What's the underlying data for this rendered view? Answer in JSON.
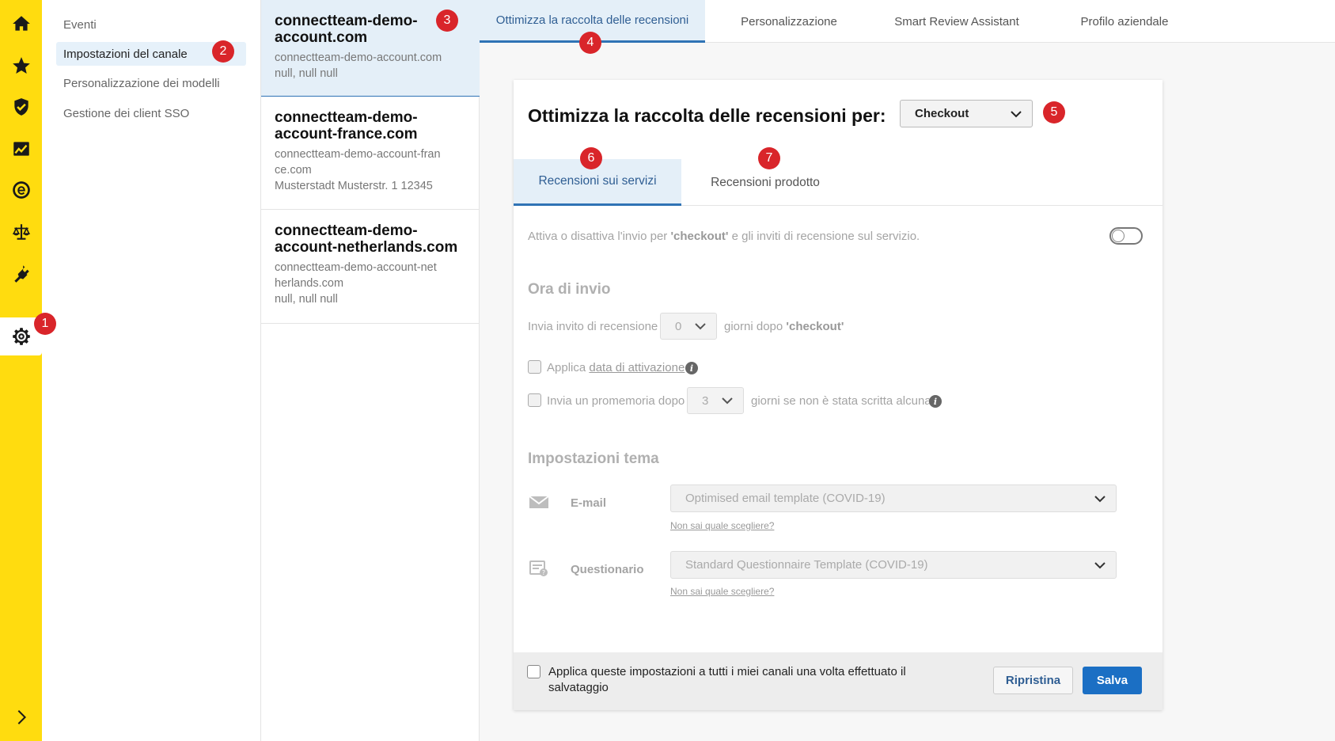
{
  "rail": {
    "items": [
      {
        "icon": "home-icon"
      },
      {
        "icon": "star-icon"
      },
      {
        "icon": "shield-check-icon"
      },
      {
        "icon": "analytics-icon"
      },
      {
        "icon": "e-circle-icon"
      },
      {
        "icon": "scales-icon"
      },
      {
        "icon": "plug-icon"
      },
      {
        "icon": "gear-icon"
      }
    ],
    "expand_icon": "chevron-right-icon"
  },
  "badges": [
    "1",
    "2",
    "3",
    "4",
    "5",
    "6",
    "7"
  ],
  "nav": {
    "items": [
      "Eventi",
      "Impostazioni del canale",
      "Personalizzazione dei modelli",
      "Gestione dei client SSO"
    ]
  },
  "accounts": [
    {
      "title": "connectteam-demo-account.com",
      "domain": "connectteam-demo-account.com",
      "address": "null, null null"
    },
    {
      "title": "connectteam-demo-account-france.com",
      "domain": "connectteam-demo-account-france.com",
      "address": "Musterstadt Musterstr. 1 12345"
    },
    {
      "title": "connectteam-demo-account-netherlands.com",
      "domain": "connectteam-demo-account-netherlands.com",
      "address": "null, null null"
    }
  ],
  "tabs": [
    "Ottimizza la raccolta delle recensioni",
    "Personalizzazione",
    "Smart Review Assistant",
    "Profilo aziendale"
  ],
  "card": {
    "title": "Ottimizza la raccolta delle recensioni per:",
    "event_select": "Checkout",
    "subtabs": [
      "Recensioni sui servizi",
      "Recensioni prodotto"
    ],
    "toggle_text_pre": "Attiva o disattiva l'invio per ",
    "toggle_text_bold": "'checkout'",
    "toggle_text_post": " e gli inviti di recensione sul servizio.",
    "send_time_heading": "Ora di invio",
    "send_invite_label": "Invia invito di recensione",
    "send_invite_days": "0",
    "days_after_pre": "giorni dopo ",
    "days_after_bold": "'checkout'",
    "apply_prefix": "Applica ",
    "apply_link": "data di attivazione",
    "reminder_label": "Invia un promemoria dopo",
    "reminder_days": "3",
    "reminder_suffix": "giorni se non è stata scritta alcuna",
    "theme_heading": "Impostazioni tema",
    "email_label": "E-mail",
    "email_template": "Optimised email template (COVID-19)",
    "email_help": "Non sai quale scegliere?",
    "questionnaire_label": "Questionario",
    "questionnaire_template": "Standard Questionnaire Template (COVID-19)",
    "questionnaire_help": "Non sai quale scegliere?",
    "footer_text": "Applica queste impostazioni a tutti i miei canali una volta effettuato il salvataggio",
    "reset_label": "Ripristina",
    "save_label": "Salva"
  }
}
